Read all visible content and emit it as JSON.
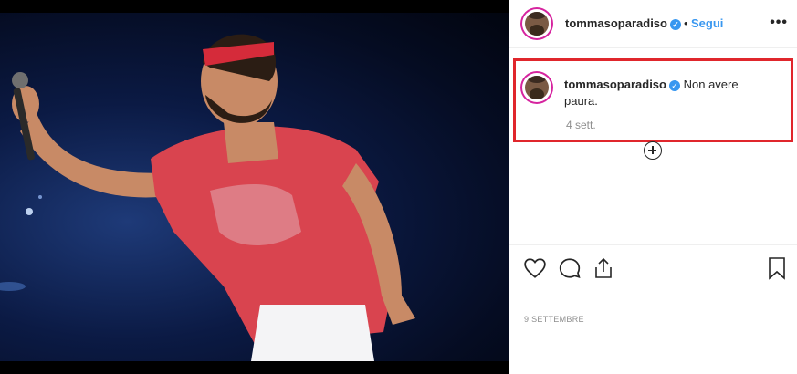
{
  "post": {
    "author": "tommasoparadiso",
    "follow_label": "Segui",
    "dot": "•",
    "more_label": "•••",
    "verified_mark": "✓"
  },
  "comment": {
    "author": "tommasoparadiso",
    "text": "Non avere paura.",
    "time": "4 sett."
  },
  "footer": {
    "date": "9 SETTEMBRE"
  },
  "icons": {
    "like": "heart-icon",
    "comment": "comment-icon",
    "share": "share-icon",
    "save": "bookmark-icon",
    "load_more": "plus-circle-icon"
  },
  "colors": {
    "accent": "#3897f0",
    "highlight": "#e0262c",
    "shirt": "#d9444f"
  }
}
